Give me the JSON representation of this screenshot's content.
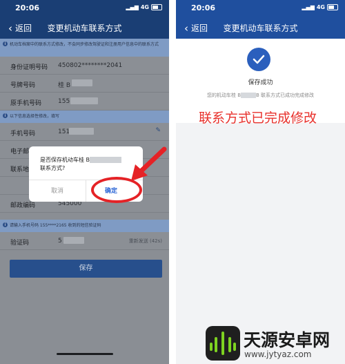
{
  "left": {
    "status": {
      "time": "20:06",
      "network": "4G"
    },
    "nav": {
      "back": "返回",
      "title": "变更机动车联系方式"
    },
    "notice1": "机动车档案中的联系方式修改，不会同步修改驾驶证和注册用户信息中的联系方式",
    "rows1": [
      {
        "label": "身份证明号码",
        "value": "450802********2041"
      },
      {
        "label": "号牌号码",
        "value": "桂 B"
      },
      {
        "label": "原手机号码",
        "value": "155"
      }
    ],
    "notice2": "以下信息选择性修改，填写",
    "rows2": [
      {
        "label": "手机号码",
        "value": "151"
      },
      {
        "label": "电子邮",
        "value": ""
      },
      {
        "label": "联系地",
        "value": ""
      },
      {
        "label": "",
        "value": ""
      },
      {
        "label": "邮政编码",
        "value": "545000"
      }
    ],
    "notice3": "请输入手机号码 155****2165 收到的短信验证码",
    "verify": {
      "label": "验证码",
      "value": "5",
      "resend": "重新发送 (42s)"
    },
    "save_button": "保存",
    "dialog": {
      "line1": "是否保存机动车桂 B",
      "line2": "联系方式?",
      "cancel": "取消",
      "ok": "确定"
    }
  },
  "right": {
    "status": {
      "time": "20:06",
      "network": "4G"
    },
    "nav": {
      "back": "返回",
      "title": "变更机动车联系方式"
    },
    "success_title": "保存成功",
    "desc_prefix": "您的机动车桂 B",
    "desc_suffix": "B 联系方式已成功完成修改",
    "annotation": "联系方式已完成修改"
  },
  "watermark": {
    "name": "天源安卓网",
    "url": "www.jytyaz.com"
  },
  "colors": {
    "nav_left": "#1a3e74",
    "nav_right": "#1f4f9e",
    "accent_red": "#e8302b",
    "ok_blue": "#2b66d6"
  }
}
